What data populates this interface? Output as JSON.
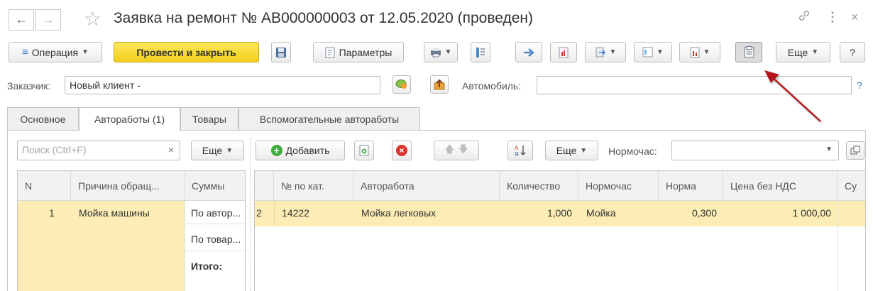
{
  "window": {
    "title": "Заявка на ремонт № АВ000000003 от 12.05.2020 (проведен)",
    "back_icon": "arrow-left-icon",
    "forward_icon": "arrow-right-icon",
    "favorite_icon": "star-icon",
    "link_icon": "link-icon",
    "more_icon": "vertical-dots-icon",
    "close_icon": "close-icon"
  },
  "toolbar": {
    "operation_label": "Операция",
    "post_close_label": "Провести и закрыть",
    "params_label": "Параметры",
    "more_label": "Еще",
    "help_label": "?"
  },
  "fields": {
    "customer_label": "Заказчик:",
    "customer_value": "Новый клиент -",
    "car_label": "Автомобиль:",
    "car_value": "",
    "help": "?"
  },
  "tabs": [
    "Основное",
    "Авторабо­ты (1)",
    "Товары",
    "Вспомогательные автоработы"
  ],
  "left": {
    "search_placeholder": "Поиск (Ctrl+F)",
    "clear": "×",
    "more_label": "Еще",
    "columns": [
      "N",
      "Причина обращ...",
      "Суммы"
    ],
    "row": {
      "n": "1",
      "reason": "Мойка машины"
    },
    "sums": [
      "По автор...",
      "По товар...",
      "Итого:"
    ]
  },
  "right": {
    "add_label": "Добавить",
    "more_label": "Еще",
    "normhour_label": "Нормочас:",
    "normhour_value": "",
    "columns": [
      "№ по кат.",
      "Авторабота",
      "Количество",
      "Нормочас",
      "Норма",
      "Цена без НДС",
      "Су"
    ],
    "row": {
      "lead": "2",
      "cat": "14222",
      "work": "Мойка легковых",
      "qty": "1,000",
      "normhour": "Мойка",
      "norm": "0,300",
      "price": "1 000,00"
    }
  },
  "annotation": {
    "arrow_color": "#b3181e"
  }
}
